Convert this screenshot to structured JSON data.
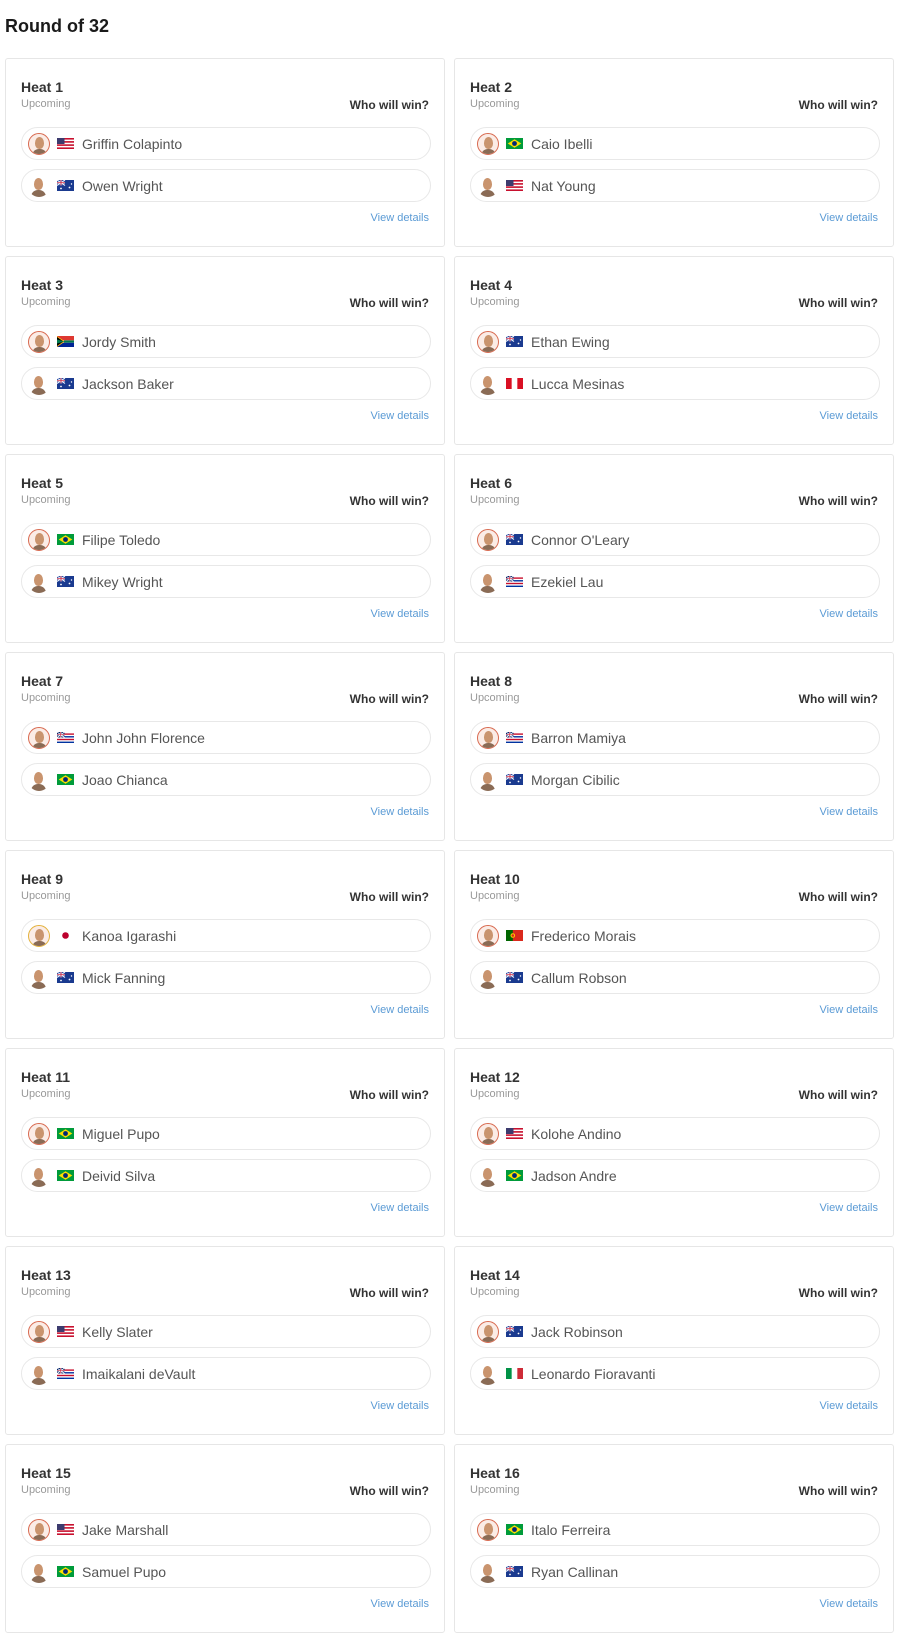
{
  "page": {
    "title": "Round of 32"
  },
  "labels": {
    "status": "Upcoming",
    "prompt": "Who will win?",
    "details": "View details"
  },
  "heats": [
    {
      "name": "Heat 1",
      "surfers": [
        {
          "name": "Griffin Colapinto",
          "country": "usa"
        },
        {
          "name": "Owen Wright",
          "country": "aus"
        }
      ]
    },
    {
      "name": "Heat 2",
      "surfers": [
        {
          "name": "Caio Ibelli",
          "country": "bra"
        },
        {
          "name": "Nat Young",
          "country": "usa"
        }
      ]
    },
    {
      "name": "Heat 3",
      "surfers": [
        {
          "name": "Jordy Smith",
          "country": "zaf"
        },
        {
          "name": "Jackson Baker",
          "country": "aus"
        }
      ]
    },
    {
      "name": "Heat 4",
      "surfers": [
        {
          "name": "Ethan Ewing",
          "country": "aus"
        },
        {
          "name": "Lucca Mesinas",
          "country": "per"
        }
      ]
    },
    {
      "name": "Heat 5",
      "surfers": [
        {
          "name": "Filipe Toledo",
          "country": "bra"
        },
        {
          "name": "Mikey Wright",
          "country": "aus"
        }
      ]
    },
    {
      "name": "Heat 6",
      "surfers": [
        {
          "name": "Connor O'Leary",
          "country": "aus"
        },
        {
          "name": "Ezekiel Lau",
          "country": "haw"
        }
      ]
    },
    {
      "name": "Heat 7",
      "surfers": [
        {
          "name": "John John Florence",
          "country": "haw"
        },
        {
          "name": "Joao Chianca",
          "country": "bra"
        }
      ]
    },
    {
      "name": "Heat 8",
      "surfers": [
        {
          "name": "Barron Mamiya",
          "country": "haw"
        },
        {
          "name": "Morgan Cibilic",
          "country": "aus"
        }
      ]
    },
    {
      "name": "Heat 9",
      "surfers": [
        {
          "name": "Kanoa Igarashi",
          "country": "jpn",
          "gold": true
        },
        {
          "name": "Mick Fanning",
          "country": "aus"
        }
      ]
    },
    {
      "name": "Heat 10",
      "surfers": [
        {
          "name": "Frederico Morais",
          "country": "prt"
        },
        {
          "name": "Callum Robson",
          "country": "aus"
        }
      ]
    },
    {
      "name": "Heat 11",
      "surfers": [
        {
          "name": "Miguel Pupo",
          "country": "bra"
        },
        {
          "name": "Deivid Silva",
          "country": "bra"
        }
      ]
    },
    {
      "name": "Heat 12",
      "surfers": [
        {
          "name": "Kolohe Andino",
          "country": "usa"
        },
        {
          "name": "Jadson Andre",
          "country": "bra"
        }
      ]
    },
    {
      "name": "Heat 13",
      "surfers": [
        {
          "name": "Kelly Slater",
          "country": "usa"
        },
        {
          "name": "Imaikalani deVault",
          "country": "haw"
        }
      ]
    },
    {
      "name": "Heat 14",
      "surfers": [
        {
          "name": "Jack Robinson",
          "country": "aus"
        },
        {
          "name": "Leonardo Fioravanti",
          "country": "ita"
        }
      ]
    },
    {
      "name": "Heat 15",
      "surfers": [
        {
          "name": "Jake Marshall",
          "country": "usa"
        },
        {
          "name": "Samuel Pupo",
          "country": "bra"
        }
      ]
    },
    {
      "name": "Heat 16",
      "surfers": [
        {
          "name": "Italo Ferreira",
          "country": "bra"
        },
        {
          "name": "Ryan Callinan",
          "country": "aus"
        }
      ]
    }
  ],
  "colors": {
    "link": "#5b9bd5",
    "ring": "#d86a50",
    "ring_gold": "#e3b23c"
  }
}
